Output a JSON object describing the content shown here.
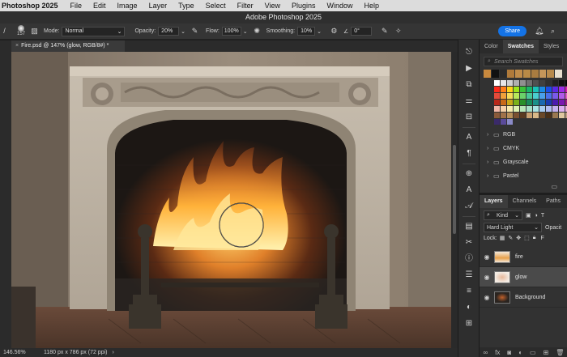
{
  "menu": {
    "app_name": "Photoshop 2025",
    "items": [
      "File",
      "Edit",
      "Image",
      "Layer",
      "Type",
      "Select",
      "Filter",
      "View",
      "Plugins",
      "Window",
      "Help"
    ]
  },
  "window": {
    "title": "Adobe Photoshop 2025"
  },
  "options_bar": {
    "brush_size": "157",
    "mode_label": "Mode:",
    "mode_value": "Normal",
    "opacity_label": "Opacity:",
    "opacity_value": "20%",
    "flow_label": "Flow:",
    "flow_value": "100%",
    "smoothing_label": "Smoothing:",
    "smoothing_value": "10%",
    "angle_value": "0°",
    "share_label": "Share"
  },
  "document": {
    "tab_title": "Fire.psd @ 147% (glow, RGB/8#) *"
  },
  "status_bar": {
    "zoom": "146.56%",
    "dimensions": "1180 px x 786 px (72 ppi)"
  },
  "swatches_panel": {
    "tabs": [
      "Color",
      "Swatches",
      "Styles"
    ],
    "active_tab": "Swatches",
    "search_placeholder": "Search Swatches",
    "recent_colors": [
      "#c8893e",
      "#111111",
      "#2a2a2a",
      "#b07a3a",
      "#c08c4a",
      "#b98a46",
      "#a97c40",
      "#c4965a",
      "#b78a4c",
      "#e8e0d0"
    ],
    "grid_colors": [
      "#ffffff",
      "#e8e8e8",
      "#d0d0d0",
      "#b0b0b0",
      "#909090",
      "#707070",
      "#505050",
      "#404040",
      "#303030",
      "#202020",
      "#101010",
      "#000000",
      "#f2f2f2",
      "#ff2a1a",
      "#ff7f1a",
      "#ffd21a",
      "#9ee51a",
      "#3ac23a",
      "#1ab56a",
      "#1ac2b8",
      "#1a8ae5",
      "#1a4ee5",
      "#5a2ae5",
      "#9a2ae5",
      "#d51ab5",
      "#e51a6a",
      "#e54a3a",
      "#f0a03a",
      "#f5dc5a",
      "#b8e85a",
      "#6ad26a",
      "#4ac89a",
      "#4acfd0",
      "#4aa0ea",
      "#4a70ea",
      "#7a5aea",
      "#b05aea",
      "#e05ac8",
      "#ea5a8a",
      "#b8281a",
      "#c86a1a",
      "#c8a81a",
      "#7ab01a",
      "#2a902a",
      "#1a8a5a",
      "#1a908a",
      "#1a68b0",
      "#1a3ab0",
      "#4a1ab0",
      "#7a1ab0",
      "#a01a88",
      "#b01a4a",
      "#f2b8a8",
      "#f5d0a8",
      "#f8ecb0",
      "#dcf0b0",
      "#b8e6b8",
      "#a8e0c8",
      "#a8e4e4",
      "#a8ccf0",
      "#b0bcf0",
      "#c4b0f0",
      "#dcb0f0",
      "#f0b0e0",
      "#f0b0c4",
      "#8a5a3a",
      "#a0724a",
      "#b8905a",
      "#7a5030",
      "#5a3a20",
      "#c8a070",
      "#d8b888",
      "#6a4828",
      "#4a3018",
      "#9a7850",
      "#e0c8a0",
      "#c0a080",
      "#a08060",
      "#3a2a6a",
      "#5a4a9a",
      "#8a8ac8"
    ],
    "folders": [
      "RGB",
      "CMYK",
      "Grayscale",
      "Pastel"
    ]
  },
  "layers_panel": {
    "tabs": [
      "Layers",
      "Channels",
      "Paths"
    ],
    "active_tab": "Layers",
    "kind_label": "Kind",
    "blend_mode": "Hard Light",
    "opacity_label": "Opacit",
    "lock_label": "Lock:",
    "fill_label": "F",
    "layers": [
      {
        "name": "fire",
        "selected": false
      },
      {
        "name": "glow",
        "selected": true
      },
      {
        "name": "Background",
        "selected": false
      }
    ]
  },
  "icons": {
    "right_tools": [
      "history-brush-icon",
      "play-icon",
      "layers-comp-icon",
      "adjustments-icon",
      "properties-icon",
      "character-icon",
      "paragraph-icon",
      "glyphs-icon",
      "type-icon",
      "libraries-icon",
      "tool-presets-icon",
      "info-icon",
      "navigator-icon",
      "channels-icon",
      "color-wheel-icon",
      "brush-settings-icon"
    ]
  }
}
